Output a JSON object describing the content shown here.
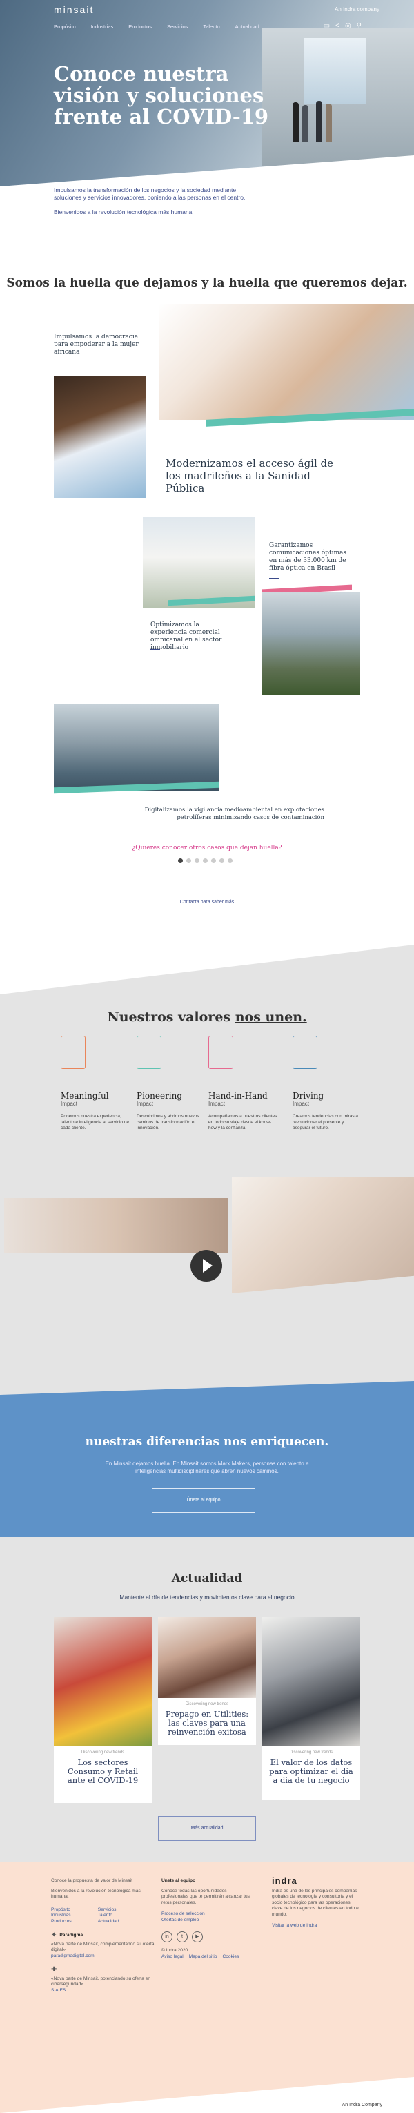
{
  "header": {
    "logo": "minsait",
    "indra_company": "An Indra company",
    "nav": [
      "Propósito",
      "Industrias",
      "Productos",
      "Servicios",
      "Talento",
      "Actualidad"
    ],
    "icons": [
      "message-icon",
      "share-icon",
      "globe-icon",
      "search-icon"
    ]
  },
  "hero": {
    "title": "Conoce nuestra visión y soluciones frente al COVID-19"
  },
  "intro": {
    "p1": "Impulsamos la transformación de los negocios y la sociedad mediante soluciones y servicios innovadores, poniendo a las personas en el centro.",
    "p2": "Bienvenidos a la revolución tecnológica más humana."
  },
  "huella": {
    "title": "Somos la huella que dejamos y la huella que queremos dejar.",
    "captions": [
      "Impulsamos la democracia para empoderar a la mujer africana",
      "Modernizamos el acceso ágil de los madrileños a la Sanidad Pública",
      "Garantizamos comunicaciones óptimas en más de 33.000 km de fibra óptica en Brasil",
      "Optimizamos la experiencia comercial omnicanal en el sector inmobiliario",
      "Digitalizamos la vigilancia medioambiental en explotaciones petrolíferas minimizando casos de contaminación"
    ],
    "more_question": "¿Quieres conocer otros casos que dejan huella?",
    "contact_button": "Contacta para saber más"
  },
  "valores": {
    "title_plain": "Nuestros valores ",
    "title_underlined": "nos unen.",
    "items": [
      {
        "name": "Meaningful",
        "sub": "Impact",
        "desc": "Ponemos nuestra experiencia, talento e inteligencia al servicio de cada cliente."
      },
      {
        "name": "Pioneering",
        "sub": "Impact",
        "desc": "Descubrimos y abrimos nuevos caminos de transformación e innovación."
      },
      {
        "name": "Hand-in-Hand",
        "sub": "Impact",
        "desc": "Acompañamos a nuestros clientes en todo su viaje desde el know-how y la confianza."
      },
      {
        "name": "Driving",
        "sub": "Impact",
        "desc": "Creamos tendencias con miras a revolucionar el presente y asegurar el futuro."
      }
    ]
  },
  "diferencias": {
    "title": "nuestras diferencias nos enriquecen.",
    "body": "En Minsait dejamos huella. En Minsait somos Mark Makers, personas con talento e inteligencias multidisciplinares que abren nuevos caminos.",
    "button": "Únete al equipo"
  },
  "actualidad": {
    "title": "Actualidad",
    "subtitle": "Mantente al día de tendencias y movimientos clave para el negocio",
    "news": [
      {
        "category": "Discovering new trends",
        "title": "Los sectores Consumo y Retail ante el COVID-19"
      },
      {
        "category": "Discovering new trends",
        "title": "Prepago en Utilities: las claves para una reinvención exitosa"
      },
      {
        "category": "Discovering new trends",
        "title": "El valor de los datos para optimizar el día a día de tu negocio"
      }
    ],
    "button": "Más actualidad"
  },
  "footer": {
    "col1_title": "Conoce la propuesta de valor de Minsait",
    "col1_text": "Bienvenidos a la revolución tecnológica más humana.",
    "links_a": [
      "Propósito",
      "Industrias",
      "Productos"
    ],
    "links_b": [
      "Servicios",
      "Talento",
      "Actualidad"
    ],
    "paradigma_label": "Paradigma",
    "paradigma_text": "«Nova parte de Minsait, complementando su oferta digital»",
    "paradigma_link": "paradigmadigital.com",
    "sia_text": "«Nova parte de Minsait, potenciando su oferta en ciberseguridad»",
    "sia_link": "SIA.ES",
    "col2_title": "Únete al equipo",
    "col2_text": "Conoce todas las oportunidades profesionales que te permitirán alcanzar tus retos personales.",
    "col2_links": [
      "Proceso de selección",
      "Ofertas de empleo"
    ],
    "social": [
      "LinkedIn",
      "Twitter",
      "YouTube"
    ],
    "copyright": "© Indra 2020",
    "legal": [
      "Aviso legal",
      "Mapa del sitio",
      "Cookies"
    ],
    "indra_logo": "indra",
    "indra_text": "Indra es una de las principales compañías globales de tecnología y consultoría y el socio tecnológico para las operaciones clave de los negocios de clientes en todo el mundo.",
    "indra_link": "Visitar la web de Indra",
    "bottom": "An Indra Company"
  },
  "colors": {
    "teal": "#5fc3b2",
    "pink": "#e66a8f",
    "blue": "#5e92c8",
    "navy": "#3a4a8a",
    "footer_bg": "#fbe1d2"
  }
}
